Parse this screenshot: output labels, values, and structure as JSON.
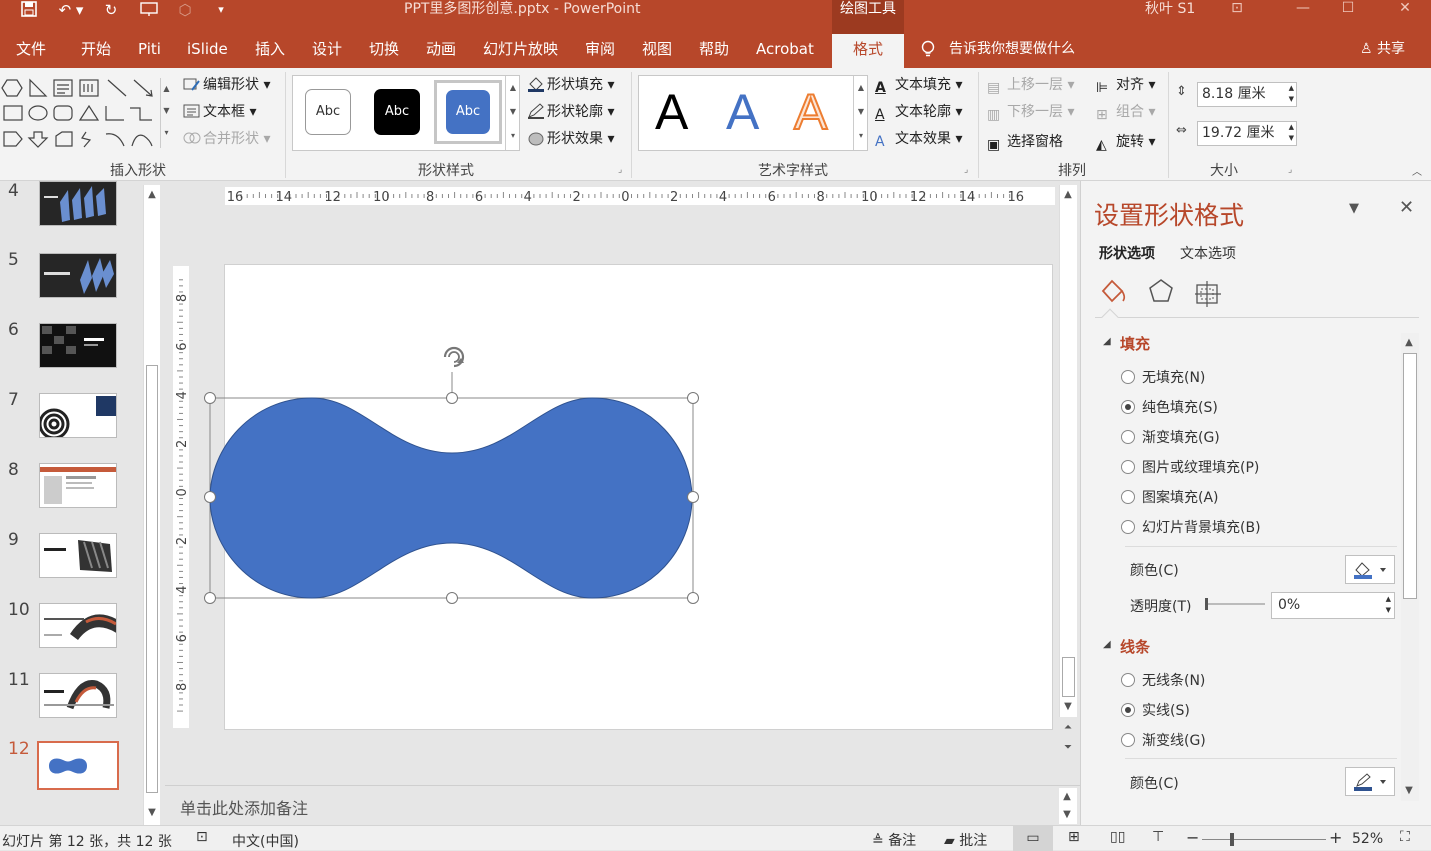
{
  "title_bar": {
    "title": "PPT里多图形创意.pptx  -  PowerPoint",
    "context_tab": "绘图工具",
    "user": "秋叶 S1"
  },
  "tabs": [
    "文件",
    "开始",
    "Piti",
    "iSlide",
    "插入",
    "设计",
    "切换",
    "动画",
    "幻灯片放映",
    "审阅",
    "视图",
    "帮助",
    "Acrobat"
  ],
  "active_tab": "格式",
  "tell_me": "告诉我你想要做什么",
  "share": "共享",
  "ribbon": {
    "insert_shapes": {
      "edit_shape": "编辑形状",
      "textbox": "文本框",
      "merge": "合并形状",
      "label": "插入形状"
    },
    "shape_styles": {
      "samples": [
        "Abc",
        "Abc",
        "Abc"
      ],
      "fill": "形状填充",
      "outline": "形状轮廓",
      "effect": "形状效果",
      "label": "形状样式"
    },
    "wordart": {
      "samples": [
        "A",
        "A",
        "A"
      ],
      "text_fill": "文本填充",
      "text_outline": "文本轮廓",
      "text_effect": "文本效果",
      "label": "艺术字样式"
    },
    "arrange": {
      "forward": "上移一层",
      "backward": "下移一层",
      "pane": "选择窗格",
      "align": "对齐",
      "group": "组合",
      "rotate": "旋转",
      "label": "排列"
    },
    "size": {
      "height": "8.18 厘米",
      "width": "19.72 厘米",
      "label": "大小"
    }
  },
  "slides": [
    "4",
    "5",
    "6",
    "7",
    "8",
    "9",
    "10",
    "11",
    "12"
  ],
  "ruler_h": [
    "16",
    "14",
    "12",
    "10",
    "8",
    "6",
    "4",
    "2",
    "0",
    "2",
    "4",
    "6",
    "8",
    "10",
    "12",
    "14",
    "16"
  ],
  "ruler_v": [
    "8",
    "6",
    "4",
    "2",
    "0",
    "2",
    "4",
    "6",
    "8"
  ],
  "notes_placeholder": "单击此处添加备注",
  "format_pane": {
    "title": "设置形状格式",
    "tab_shape": "形状选项",
    "tab_text": "文本选项",
    "fill_section": "填充",
    "fill_options": [
      "无填充(N)",
      "纯色填充(S)",
      "渐变填充(G)",
      "图片或纹理填充(P)",
      "图案填充(A)",
      "幻灯片背景填充(B)"
    ],
    "fill_selected": 1,
    "color_label": "颜色(C)",
    "transparency_label": "透明度(T)",
    "transparency_value": "0%",
    "line_section": "线条",
    "line_options": [
      "无线条(N)",
      "实线(S)",
      "渐变线(G)"
    ],
    "line_selected": 1,
    "line_color_label": "颜色(C)"
  },
  "status": {
    "slide_info": "幻灯片 第 12 张，共 12 张",
    "language": "中文(中国)",
    "notes": "备注",
    "comments": "批注",
    "zoom": "52%"
  },
  "colors": {
    "accent": "#b7472a",
    "shape_fill": "#4472c4"
  }
}
